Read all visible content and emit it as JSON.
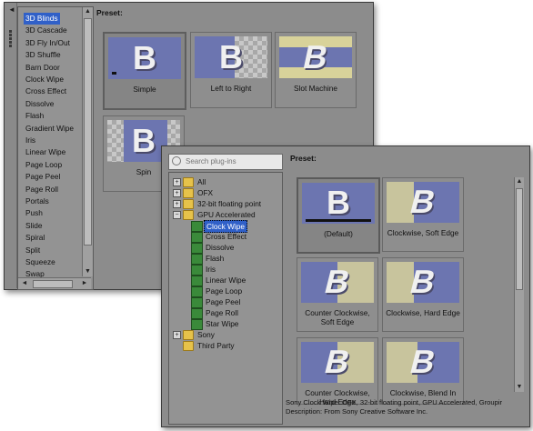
{
  "back_window": {
    "preset_label": "Preset:",
    "fx_list": [
      "3D Blinds",
      "3D Cascade",
      "3D Fly In/Out",
      "3D Shuffle",
      "Barn Door",
      "Clock Wipe",
      "Cross Effect",
      "Dissolve",
      "Flash",
      "Gradient Wipe",
      "Iris",
      "Linear Wipe",
      "Page Loop",
      "Page Peel",
      "Page Roll",
      "Portals",
      "Push",
      "Slide",
      "Spiral",
      "Split",
      "Squeeze",
      "Swap"
    ],
    "presets": [
      "Simple",
      "Left to Right",
      "Slot Machine",
      "Spin"
    ],
    "thumb_letter": "B",
    "hscroll_arrow_left": "◄",
    "hscroll_arrow_right": "►",
    "vscroll_up": "▲",
    "vscroll_down": "▼"
  },
  "front_window": {
    "search_placeholder": "Search plug-ins",
    "preset_label": "Preset:",
    "tree": [
      {
        "label": "All",
        "expander": "+"
      },
      {
        "label": "OFX",
        "expander": "+"
      },
      {
        "label": "32-bit floating point",
        "expander": "+"
      },
      {
        "label": "GPU Accelerated",
        "expander": "−"
      },
      {
        "label": "Clock Wipe"
      },
      {
        "label": "Cross Effect"
      },
      {
        "label": "Dissolve"
      },
      {
        "label": "Flash"
      },
      {
        "label": "Iris"
      },
      {
        "label": "Linear Wipe"
      },
      {
        "label": "Page Loop"
      },
      {
        "label": "Page Peel"
      },
      {
        "label": "Page Roll"
      },
      {
        "label": "Star Wipe"
      },
      {
        "label": "Sony",
        "expander": "+"
      },
      {
        "label": "Third Party"
      }
    ],
    "presets": [
      "(Default)",
      "Clockwise, Soft Edge",
      "Counter Clockwise, Soft Edge",
      "Clockwise, Hard Edge",
      "Counter Clockwise, Hard Edge",
      "Clockwise, Blend In"
    ],
    "thumb_letter": "B",
    "status_line1": "Sony Clock Wipe: OFX, 32-bit floating point, GPU Accelerated, Groupir",
    "status_line2": "Description: From Sony Creative Software Inc."
  }
}
